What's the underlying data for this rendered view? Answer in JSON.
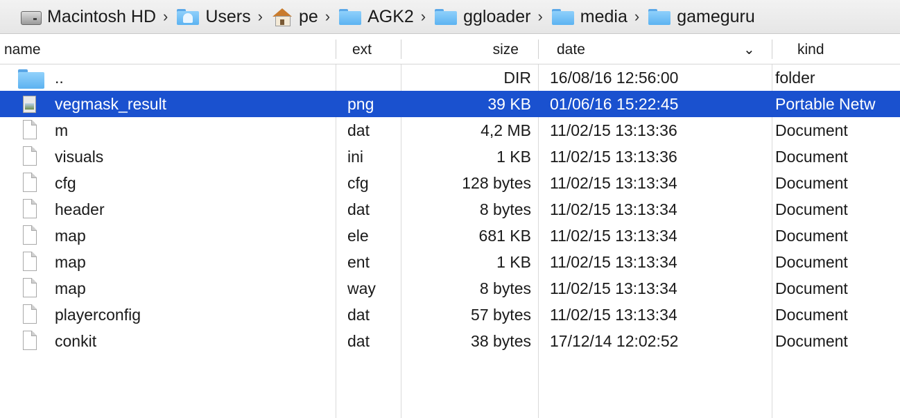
{
  "breadcrumb": [
    {
      "label": "Macintosh HD",
      "icon": "hard-drive-icon"
    },
    {
      "label": "Users",
      "icon": "users-folder-icon"
    },
    {
      "label": "pe",
      "icon": "home-icon"
    },
    {
      "label": "AGK2",
      "icon": "folder-icon"
    },
    {
      "label": "ggloader",
      "icon": "folder-icon"
    },
    {
      "label": "media",
      "icon": "folder-icon"
    },
    {
      "label": "gameguru",
      "icon": "folder-icon"
    }
  ],
  "breadcrumb_separator": "›",
  "columns": {
    "name": "name",
    "ext": "ext",
    "size": "size",
    "date": "date",
    "date_sort_indicator": "⌄",
    "kind": "kind"
  },
  "selected_color": "#1a51cf",
  "rows": [
    {
      "icon": "folder-icon",
      "name": "..",
      "ext": "",
      "size": "DIR",
      "date": "16/08/16 12:56:00",
      "kind": "folder",
      "selected": false
    },
    {
      "icon": "image-file-icon",
      "name": "vegmask_result",
      "ext": "png",
      "size": "39 KB",
      "date": "01/06/16 15:22:45",
      "kind": "Portable Netw",
      "selected": true
    },
    {
      "icon": "document-icon",
      "name": "m",
      "ext": "dat",
      "size": "4,2 MB",
      "date": "11/02/15 13:13:36",
      "kind": "Document",
      "selected": false
    },
    {
      "icon": "document-icon",
      "name": "visuals",
      "ext": "ini",
      "size": "1 KB",
      "date": "11/02/15 13:13:36",
      "kind": "Document",
      "selected": false
    },
    {
      "icon": "document-icon",
      "name": "cfg",
      "ext": "cfg",
      "size": "128 bytes",
      "date": "11/02/15 13:13:34",
      "kind": "Document",
      "selected": false
    },
    {
      "icon": "document-icon",
      "name": "header",
      "ext": "dat",
      "size": "8 bytes",
      "date": "11/02/15 13:13:34",
      "kind": "Document",
      "selected": false
    },
    {
      "icon": "document-icon",
      "name": "map",
      "ext": "ele",
      "size": "681 KB",
      "date": "11/02/15 13:13:34",
      "kind": "Document",
      "selected": false
    },
    {
      "icon": "document-icon",
      "name": "map",
      "ext": "ent",
      "size": "1 KB",
      "date": "11/02/15 13:13:34",
      "kind": "Document",
      "selected": false
    },
    {
      "icon": "document-icon",
      "name": "map",
      "ext": "way",
      "size": "8 bytes",
      "date": "11/02/15 13:13:34",
      "kind": "Document",
      "selected": false
    },
    {
      "icon": "document-icon",
      "name": "playerconfig",
      "ext": "dat",
      "size": "57 bytes",
      "date": "11/02/15 13:13:34",
      "kind": "Document",
      "selected": false
    },
    {
      "icon": "document-icon",
      "name": "conkit",
      "ext": "dat",
      "size": "38 bytes",
      "date": "17/12/14 12:02:52",
      "kind": "Document",
      "selected": false
    }
  ]
}
